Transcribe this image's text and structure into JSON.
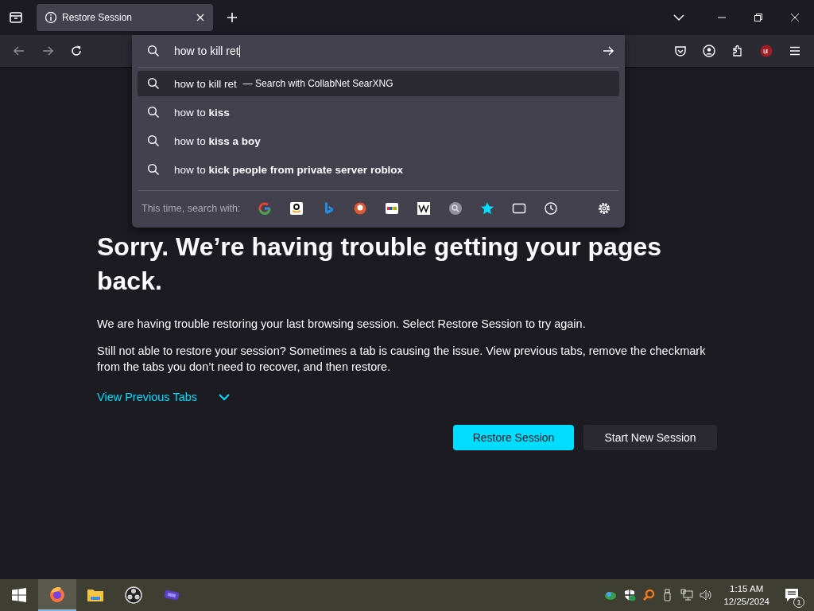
{
  "tabs": [
    {
      "title": "Restore Session",
      "selected": true
    }
  ],
  "address_bar": {
    "value": "how to kill ret"
  },
  "suggestions": [
    {
      "text": "how to kill ret",
      "action": "— Search with CollabNet SearXNG",
      "selected": true
    },
    {
      "text": "how to **kiss**",
      "selected": false
    },
    {
      "text": "how to **kiss a boy**",
      "selected": false
    },
    {
      "text": "how to **kick people from private server roblox**",
      "selected": false
    }
  ],
  "search_with": {
    "label": "This time, search with:",
    "engines": [
      {
        "kind": "google"
      },
      {
        "kind": "amazon"
      },
      {
        "kind": "bing"
      },
      {
        "kind": "duck"
      },
      {
        "kind": "ebay"
      },
      {
        "kind": "wiki"
      },
      {
        "kind": "grey"
      },
      {
        "kind": "star"
      },
      {
        "kind": "tabs"
      },
      {
        "kind": "history"
      }
    ]
  },
  "page": {
    "heading": "Sorry. We’re having trouble getting your pages back.",
    "paragraphs": [
      "We are having trouble restoring your last browsing session. Select Restore Session to try again.",
      "Still not able to restore your session? Sometimes a tab is causing the issue. View previous tabs, remove the checkmark from the tabs you don’t need to recover, and then restore."
    ],
    "toggle": "View Previous Tabs",
    "buttons": [
      {
        "label": "Restore Session",
        "primary": true
      },
      {
        "label": "Start New Session",
        "primary": false
      }
    ]
  },
  "taskbar": {
    "apps": [
      {
        "kind": "firefox",
        "selected": true
      },
      {
        "kind": "folder",
        "selected": false
      },
      {
        "kind": "obs",
        "selected": false
      },
      {
        "kind": "purple",
        "selected": false
      }
    ],
    "time": "1:15 AM",
    "date": "12/25/2024",
    "notifications": "1"
  }
}
